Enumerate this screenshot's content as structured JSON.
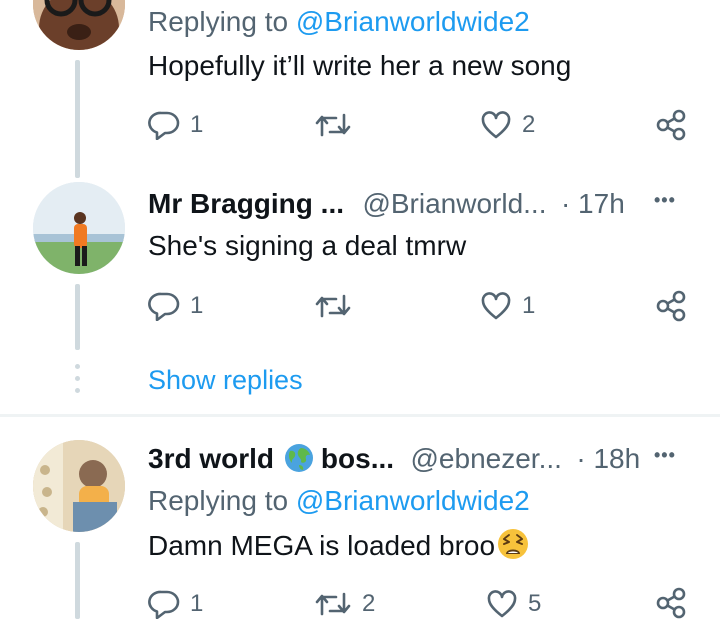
{
  "tweets": [
    {
      "reply_prefix": "Replying to",
      "reply_handle": "@Brianworldwide2",
      "text": "Hopefully it’ll write her a new song",
      "reply_count": "1",
      "retweet_count": "",
      "like_count": "2"
    },
    {
      "name": "Mr Bragging ...",
      "handle": "@Brianworld...",
      "time": "· 17h",
      "text": "She's signing a deal tmrw",
      "reply_count": "1",
      "retweet_count": "",
      "like_count": "1",
      "show_replies": "Show replies"
    },
    {
      "name_part1": "3rd world",
      "name_part2": "bos...",
      "handle": "@ebnezer...",
      "time": "· 18h",
      "reply_prefix": "Replying to",
      "reply_handle": "@Brianworldwide2",
      "text": "Damn MEGA is loaded broo",
      "reply_count": "1",
      "retweet_count": "2",
      "like_count": "5"
    }
  ],
  "more_label": "•••",
  "colors": {
    "link": "#1d9bf0",
    "muted": "#536471",
    "text": "#0f1419",
    "thread_line": "#cfd9de"
  },
  "icons": [
    "reply-icon",
    "retweet-icon",
    "like-icon",
    "share-icon",
    "more-icon",
    "globe-emoji",
    "tired-face-emoji"
  ]
}
